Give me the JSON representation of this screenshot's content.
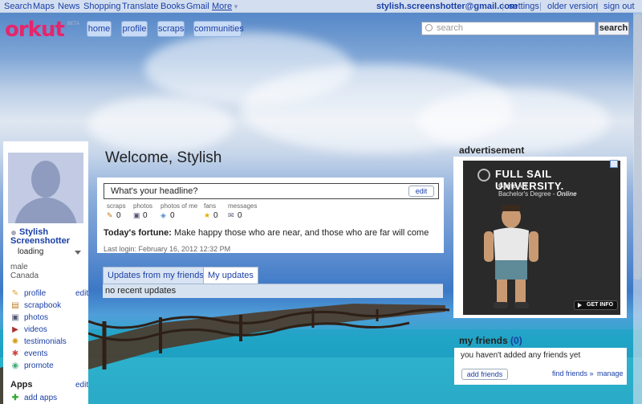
{
  "gbar": {
    "links": [
      "Search",
      "Maps",
      "News",
      "Shopping",
      "Translate",
      "Books",
      "Gmail",
      "More"
    ],
    "email": "stylish.screenshotter@gmail.com",
    "settings": "settings",
    "older_version": "older version",
    "sign_out": "sign out"
  },
  "header": {
    "logo": "orkut",
    "beta": "BETA",
    "nav": [
      "home",
      "profile",
      "scraps",
      "communities"
    ],
    "search_placeholder": "search",
    "search_button": "search"
  },
  "profile": {
    "name": "Stylish Screenshotter",
    "status": "loading",
    "gender": "male",
    "country": "Canada",
    "links": [
      {
        "label": "profile",
        "icon": "pencil-icon",
        "edit": "edit"
      },
      {
        "label": "scrapbook",
        "icon": "scrapbook-icon"
      },
      {
        "label": "photos",
        "icon": "photo-icon"
      },
      {
        "label": "videos",
        "icon": "video-icon"
      },
      {
        "label": "testimonials",
        "icon": "testimonial-icon"
      },
      {
        "label": "events",
        "icon": "events-icon"
      },
      {
        "label": "promote",
        "icon": "promote-icon"
      }
    ],
    "apps_title": "Apps",
    "apps_edit": "edit",
    "add_apps": "add apps"
  },
  "main": {
    "welcome": "Welcome, Stylish",
    "headline": "What's your headline?",
    "headline_edit": "edit",
    "stats": [
      {
        "label": "scraps",
        "value": "0",
        "icon": "scrap-icon"
      },
      {
        "label": "photos",
        "value": "0",
        "icon": "photos-icon"
      },
      {
        "label": "photos of me",
        "value": "0",
        "icon": "tag-icon"
      },
      {
        "label": "fans",
        "value": "0",
        "icon": "star-icon"
      },
      {
        "label": "messages",
        "value": "0",
        "icon": "envelope-icon"
      }
    ],
    "fortune_label": "Today's fortune:",
    "fortune_text": "Make happy those who are near, and those who are far will come",
    "last_login": "Last login: February 16, 2012 12:32 PM",
    "tabs": [
      "Updates from my friends",
      "My updates"
    ],
    "no_updates": "no recent updates"
  },
  "right": {
    "ad_title": "advertisement",
    "ad_brand": "FULL SAIL UNIVERSITY.",
    "ad_sub1": "Game Art",
    "ad_sub2a": "Bachelor's Degree - ",
    "ad_sub2b": "Online",
    "ad_cta": "GET INFO",
    "friends_title": "my friends",
    "friends_count": "(0)",
    "friends_msg": "you haven't added any friends yet",
    "add_friends": "add friends",
    "find_friends": "find friends »",
    "manage": "manage"
  }
}
